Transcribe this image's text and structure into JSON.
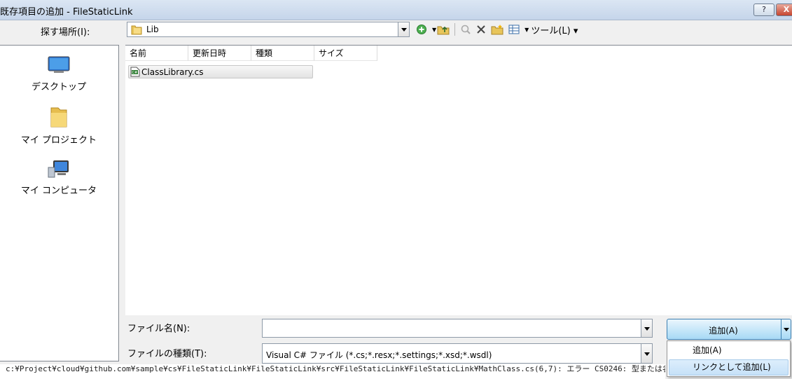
{
  "window": {
    "title": "既存項目の追加 - FileStaticLink",
    "help_btn": "?",
    "close_btn": "X"
  },
  "look_in": {
    "label": "探す場所(I):",
    "value": "Lib"
  },
  "toolbar": {
    "tools_label": "ツール(L)",
    "icons": [
      "back-icon",
      "up-folder-icon",
      "search-web-icon",
      "delete-icon",
      "new-folder-icon",
      "views-icon"
    ]
  },
  "places": [
    {
      "label": "デスクトップ",
      "icon": "desktop-icon"
    },
    {
      "label": "マイ プロジェクト",
      "icon": "folder-icon"
    },
    {
      "label": "マイ コンピュータ",
      "icon": "computer-icon"
    }
  ],
  "file_list": {
    "columns": [
      "名前",
      "更新日時",
      "種類",
      "サイズ"
    ],
    "items": [
      {
        "name": "ClassLibrary.cs",
        "icon": "csharp-file-icon"
      }
    ]
  },
  "file_name": {
    "label": "ファイル名(N):",
    "value": ""
  },
  "file_type": {
    "label": "ファイルの種類(T):",
    "value": "Visual C# ファイル (*.cs;*.resx;*.settings;*.xsd;*.wsdl)"
  },
  "add_button": {
    "label": "追加(A)"
  },
  "add_menu": {
    "items": [
      "追加(A)",
      "リンクとして追加(L)"
    ]
  },
  "status_text": "c:¥Project¥cloud¥github.com¥sample¥cs¥FileStaticLink¥FileStaticLink¥src¥FileStaticLink¥FileStaticLink¥MathClass.cs(6,7): エラー CS0246: 型または名前空間名 ..."
}
